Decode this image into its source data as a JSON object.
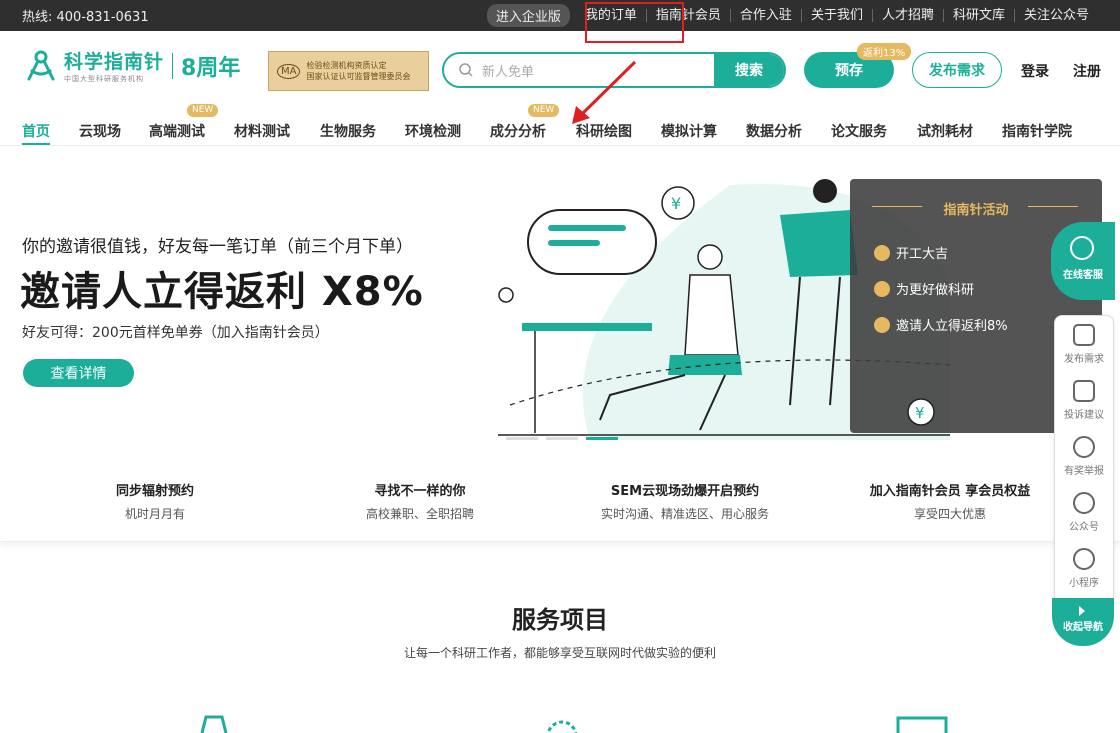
{
  "topbar": {
    "hotline": "热线: 400-831-0631",
    "enterprise": "进入企业版",
    "links": [
      "我的订单",
      "指南针会员",
      "合作入驻",
      "关于我们",
      "人才招聘",
      "科研文库",
      "关注公众号"
    ]
  },
  "logo": {
    "name": "科学指南针",
    "tagline": "中国大型科研服务机构",
    "years": "8周年"
  },
  "cma": {
    "mark": "MA",
    "line1": "检验检测机构资质认定",
    "line2": "国家认证认可监督管理委员会"
  },
  "search": {
    "placeholder": "新人免单",
    "button": "搜索"
  },
  "actions": {
    "preorder": "预存",
    "rebate": "返利13%",
    "publish": "发布需求",
    "login": "登录",
    "register": "注册"
  },
  "nav": {
    "items": [
      "首页",
      "云现场",
      "高端测试",
      "材料测试",
      "生物服务",
      "环境检测",
      "成分分析",
      "科研绘图",
      "模拟计算",
      "数据分析",
      "论文服务",
      "试剂耗材",
      "指南针学院"
    ],
    "new_tag": "NEW"
  },
  "hero": {
    "line1": "你的邀请很值钱，好友每一笔订单（前三个月下单）",
    "line2": "邀请人立得返利 X8%",
    "line3": "好友可得：200元首样免单券（加入指南针会员）",
    "button": "查看详情"
  },
  "activity": {
    "title": "指南针活动",
    "items": [
      "开工大吉",
      "为更好做科研",
      "邀请人立得返利8%"
    ]
  },
  "features": [
    {
      "title": "同步辐射预约",
      "sub": "机时月月有"
    },
    {
      "title": "寻找不一样的你",
      "sub": "高校兼职、全职招聘"
    },
    {
      "title": "SEM云现场劲爆开启预约",
      "sub": "实时沟通、精准选区、用心服务"
    },
    {
      "title": "加入指南针会员 享会员权益",
      "sub": "享受四大优惠"
    }
  ],
  "services": {
    "title": "服务项目",
    "subtitle": "让每一个科研工作者，都能够享受互联网时代做实验的便利"
  },
  "sidebar": {
    "online": "在线客服",
    "items": [
      "发布需求",
      "投诉建议",
      "有奖举报",
      "公众号",
      "小程序"
    ],
    "collapse": "收起导航"
  },
  "colors": {
    "brand": "#1dae9a",
    "gold": "#e6b85f",
    "topbar": "#2f2f2f",
    "highlight": "#e02020"
  }
}
